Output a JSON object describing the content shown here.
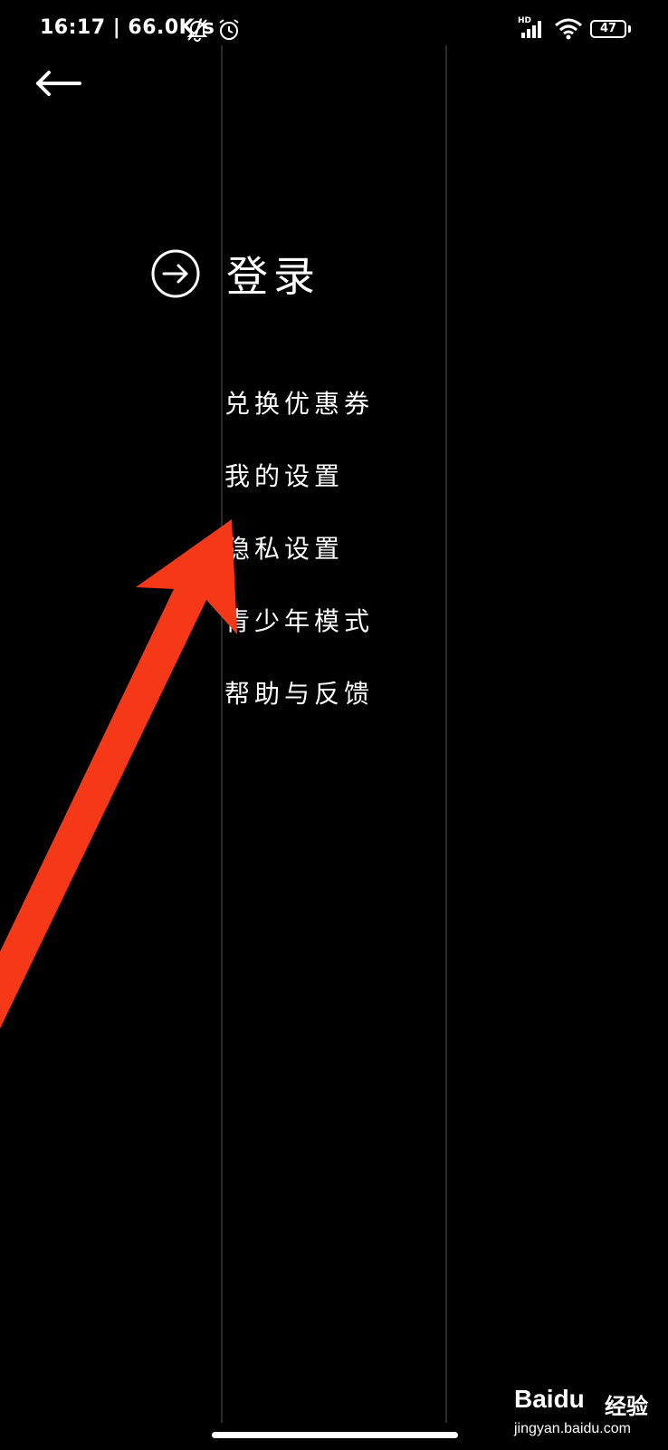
{
  "status_bar": {
    "time_speed": "16:17 | 66.0K/s",
    "network_label": "HD",
    "battery_text": "47",
    "battery_level": 0.47,
    "icons": [
      "mute-bell-icon",
      "alarm-icon",
      "signal-icon",
      "wifi-icon",
      "battery-icon"
    ]
  },
  "header": {
    "back_icon": "arrow-left-icon"
  },
  "login": {
    "icon": "arrow-right-circle-icon",
    "label": "登录"
  },
  "menu": {
    "items": [
      "兑换优惠券",
      "我的设置",
      "隐私设置",
      "青少年模式",
      "帮助与反馈"
    ]
  },
  "annotation": {
    "arrow_color": "#f43818"
  },
  "watermark": {
    "logo_left": "Bai",
    "logo_right": "du",
    "label": "经验",
    "url": "jingyan.baidu.com"
  }
}
